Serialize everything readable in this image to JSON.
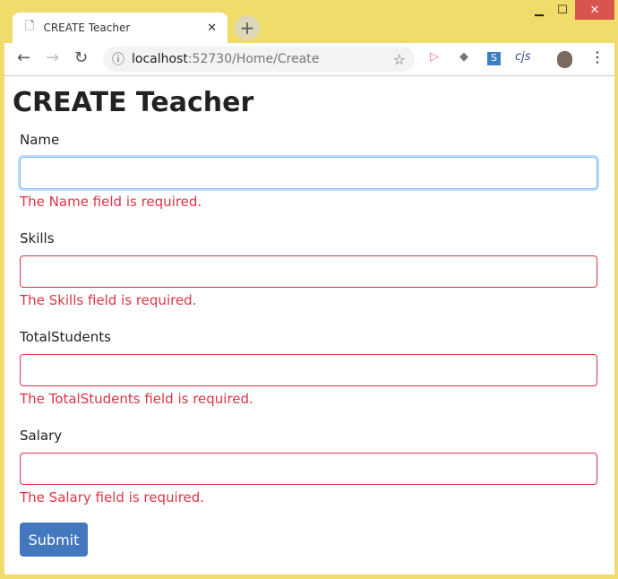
{
  "window": {
    "minimize": "▁",
    "maximize": "☐",
    "close": "✕",
    "close_color": "#d9534f"
  },
  "tab": {
    "title": "CREATE Teacher",
    "close": "✕",
    "new_tab": "+"
  },
  "toolbar": {
    "url_host": "localhost",
    "url_path": ":52730/Home/Create",
    "extensions": [
      "cjs"
    ]
  },
  "page": {
    "title": "CREATE Teacher",
    "fields": [
      {
        "label": "Name",
        "value": "",
        "error": "The Name field is required."
      },
      {
        "label": "Skills",
        "value": "",
        "error": "The Skills field is required."
      },
      {
        "label": "TotalStudents",
        "value": "",
        "error": "The TotalStudents field is required."
      },
      {
        "label": "Salary",
        "value": "",
        "error": "The Salary field is required."
      }
    ],
    "submit": "Submit"
  }
}
